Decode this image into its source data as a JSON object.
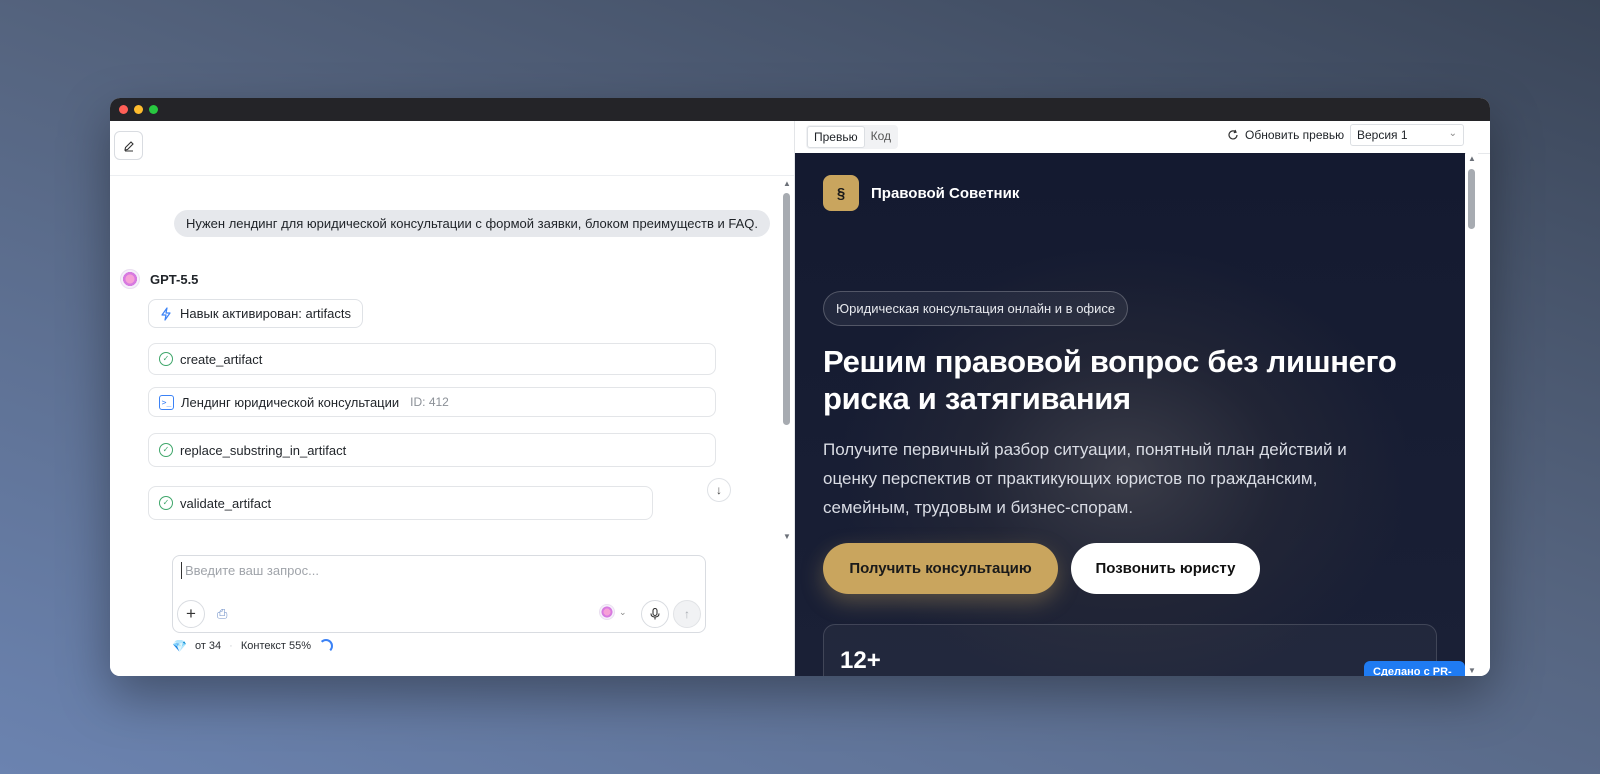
{
  "left": {
    "user_message": "Нужен лендинг для юридической консультации с формой заявки, блоком преимуществ и FAQ.",
    "assistant_name": "GPT-5.5",
    "skill_label": "Навык активирован: artifacts",
    "tools": [
      {
        "name": "create_artifact"
      },
      {
        "name": "Лендинг юридической консультации",
        "id": "ID: 412"
      },
      {
        "name": "replace_substring_in_artifact"
      },
      {
        "name": "validate_artifact"
      }
    ],
    "composer_placeholder": "Введите ваш запрос...",
    "footer": {
      "credits": "от 34",
      "context": "Контекст 55%"
    }
  },
  "right": {
    "tabs": [
      "Превью",
      "Код"
    ],
    "refresh_label": "Обновить превью",
    "version_selected": "Версия 1",
    "preview": {
      "brand_mark": "§",
      "brand_name": "Правовой Советник",
      "pill": "Юридическая консультация онлайн и в офисе",
      "headline": "Решим правовой вопрос без лишнего риска и затягивания",
      "lead": "Получите первичный разбор ситуации, понятный план действий и оценку перспектив от практикующих юристов по гражданским, семейным, трудовым и бизнес-спорам.",
      "cta_primary": "Получить консультацию",
      "cta_secondary": "Позвонить юристу",
      "stat_number": "12+",
      "badge": "Сделано с PR-CY"
    }
  },
  "colors": {
    "accent_gold": "#c9a55e",
    "badge_blue": "#1f7bf2",
    "dark_bg": "#141a30"
  }
}
